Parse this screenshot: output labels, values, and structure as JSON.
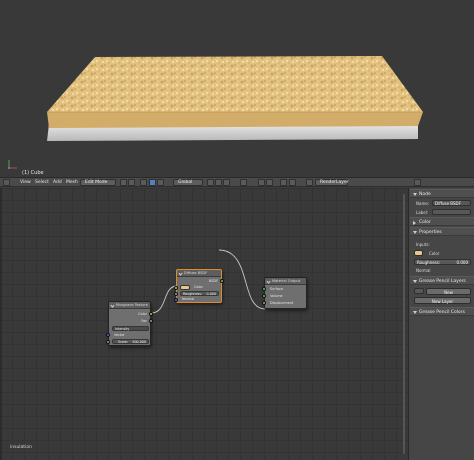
{
  "viewport": {
    "object_label": "(1) Cube"
  },
  "header": {
    "menu": [
      "View",
      "Select",
      "Add",
      "Mesh"
    ],
    "mode": "Edit Mode",
    "orientation": "Global",
    "render_layer": "RenderLayer"
  },
  "nodes": {
    "diffuse": {
      "title": "Diffuse BSDF",
      "output": "BSDF",
      "color_label": "Color",
      "roughness_label": "Roughness:",
      "roughness_value": "0.000",
      "normal_label": "Normal"
    },
    "noise": {
      "title": "Musgrave Texture",
      "out_color": "Color",
      "out_fac": "Fac",
      "type": "Intensity",
      "vector_label": "Vector",
      "scale_label": "Scale:",
      "scale_value": "500.000"
    },
    "output": {
      "title": "Material Output",
      "surface": "Surface",
      "volume": "Volume",
      "displacement": "Displacement"
    },
    "frame_label": "insulation"
  },
  "sidebar": {
    "node_header": "Node",
    "name_label": "Name:",
    "name_value": "Diffuse BSDF",
    "label_label": "Label:",
    "color_header": "Color",
    "properties_header": "Properties",
    "inputs_label": "Inputs:",
    "color_label": "Color",
    "roughness_label": "Roughness:",
    "roughness_value": "0.000",
    "normal_label": "Normal",
    "gp_layers_header": "Grease Pencil Layers",
    "new_btn": "New",
    "new_layer_btn": "New Layer",
    "gp_colors_header": "Grease Pencil Colors"
  },
  "colors": {
    "sand": "#e6c787",
    "selected_node_outline": "#e08a2c"
  }
}
